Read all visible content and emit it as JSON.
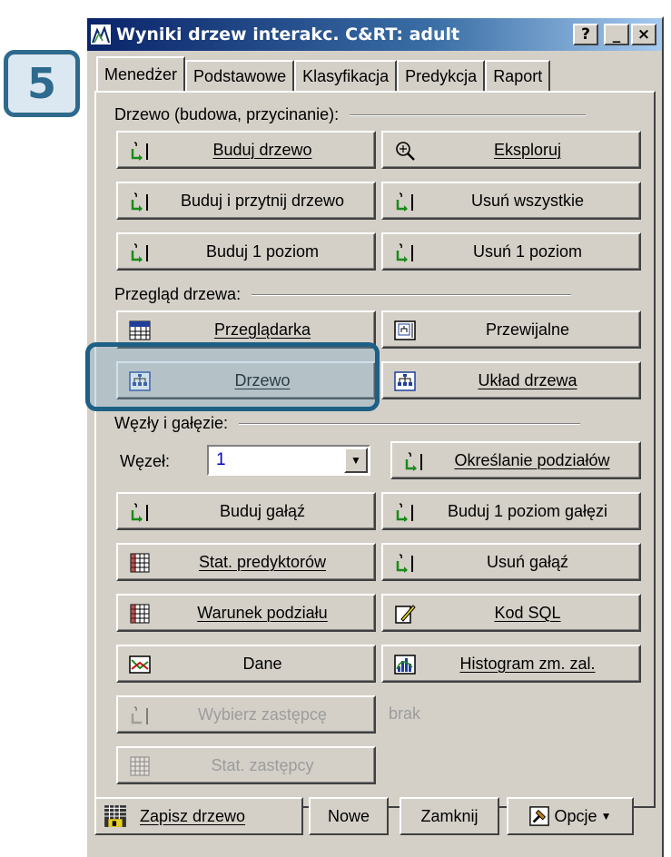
{
  "step_badge": "5",
  "window": {
    "title": "Wyniki drzew interakc. C&RT: adult",
    "controls": [
      "?",
      "_",
      "×"
    ]
  },
  "tabs": [
    "Menedżer",
    "Podstawowe",
    "Klasyfikacja",
    "Predykcja",
    "Raport"
  ],
  "groups": {
    "tree": "Drzewo (budowa, przycinanie):",
    "review": "Przegląd drzewa:",
    "nodes": "Węzły i gałęzie:"
  },
  "buttons": {
    "build_tree": "Buduj drzewo",
    "explore": "Eksploruj",
    "build_prune": "Buduj i przytnij drzewo",
    "remove_all": "Usuń wszystkie",
    "build_1_level": "Buduj 1 poziom",
    "remove_1_level": "Usuń 1 poziom",
    "browser": "Przeglądarka",
    "scrollable": "Przewijalne",
    "tree": "Drzewo",
    "tree_layout": "Układ drzewa",
    "split_def": "Określanie podziałów",
    "build_branch": "Buduj gałąź",
    "build_1_level_branch": "Buduj 1 poziom gałęzi",
    "pred_stats": "Stat. predyktorów",
    "remove_branch": "Usuń gałąź",
    "split_condition": "Warunek podziału",
    "sql_code": "Kod SQL",
    "data": "Dane",
    "histogram": "Histogram zm. zal.",
    "choose_surrogate": "Wybierz zastępcę",
    "surrogate_stats": "Stat. zastępcy"
  },
  "node": {
    "label": "Węzeł:",
    "value": "1"
  },
  "surrogate_value": "brak",
  "bottom": {
    "save_tree": "Zapisz drzewo",
    "new": "Nowe",
    "close": "Zamknij",
    "options": "Opcje"
  },
  "colors": {
    "titlebar_start": "#0a246a",
    "highlight": "#1e5f86",
    "face": "#d4d0c8"
  }
}
